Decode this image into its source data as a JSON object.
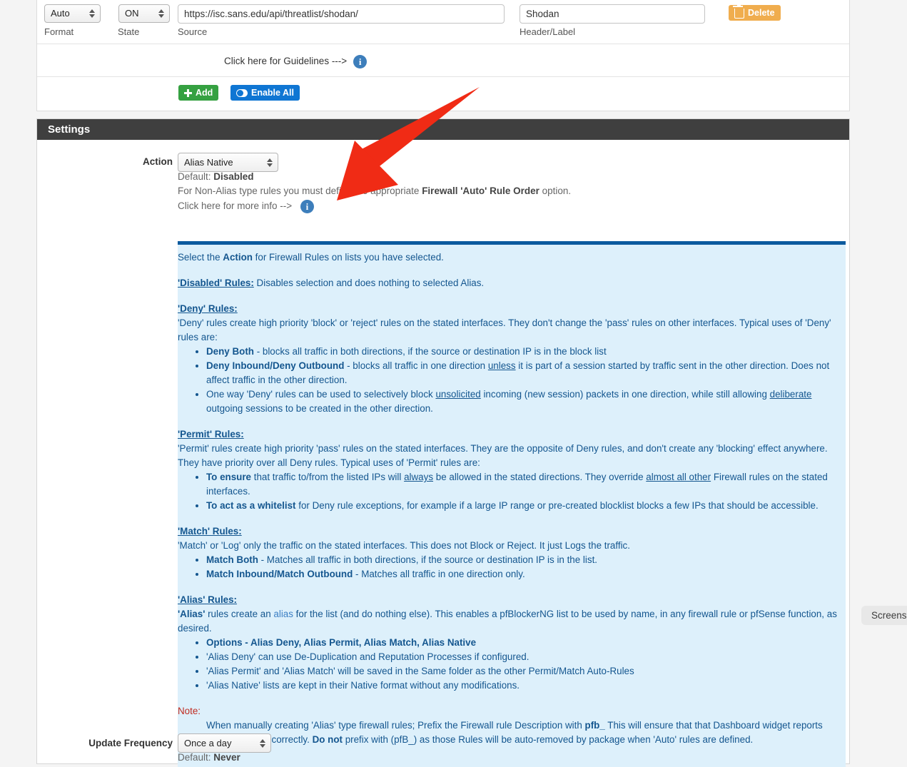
{
  "source_row": {
    "format": {
      "value": "Auto",
      "label": "Format"
    },
    "state": {
      "value": "ON",
      "label": "State"
    },
    "source": {
      "value": "https://isc.sans.edu/api/threatlist/shodan/",
      "label": "Source"
    },
    "header": {
      "value": "Shodan",
      "label": "Header/Label"
    },
    "delete_button": "Delete"
  },
  "guidelines_row": {
    "text": "Click here for Guidelines --->",
    "info_icon": "info-icon"
  },
  "actions_row": {
    "add_button": "Add",
    "enable_all_button": "Enable All"
  },
  "settings": {
    "heading": "Settings",
    "action": {
      "label": "Action",
      "value": "Alias Native",
      "default_prefix": "Default: ",
      "default_value": "Disabled",
      "note_pre": "For Non-Alias type rules you must define the appropriate ",
      "note_bold": "Firewall 'Auto' Rule Order",
      "note_post": " option.",
      "more_info": "Click here for more info -->"
    },
    "update_frequency": {
      "label": "Update Frequency",
      "value": "Once a day",
      "default_prefix": "Default: ",
      "default_value": "Never"
    }
  },
  "info_box": {
    "intro_pre": "Select the ",
    "intro_bold": "Action",
    "intro_post": " for Firewall Rules on lists you have selected.",
    "disabled_hdr": "'Disabled' Rules:",
    "disabled_text": " Disables selection and does nothing to selected Alias.",
    "deny_hdr": "'Deny' Rules:",
    "deny_intro": "'Deny' rules create high priority 'block' or 'reject' rules on the stated interfaces. They don't change the 'pass' rules on other interfaces. Typical uses of 'Deny' rules are:",
    "deny_b1_bold": "Deny Both",
    "deny_b1_rest": " - blocks all traffic in both directions, if the source or destination IP is in the block list",
    "deny_b2_bold": "Deny Inbound/Deny Outbound",
    "deny_b2_a": " - blocks all traffic in one direction ",
    "deny_b2_u": "unless",
    "deny_b2_b": " it is part of a session started by traffic sent in the other direction. Does not affect traffic in the other direction.",
    "deny_b3_a": "One way 'Deny' rules can be used to selectively block ",
    "deny_b3_u1": "unsolicited",
    "deny_b3_b": " incoming (new session) packets in one direction, while still allowing ",
    "deny_b3_u2": "deliberate",
    "deny_b3_c": " outgoing sessions to be created in the other direction.",
    "permit_hdr": "'Permit' Rules:",
    "permit_intro": "'Permit' rules create high priority 'pass' rules on the stated interfaces. They are the opposite of Deny rules, and don't create any 'blocking' effect anywhere. They have priority over all Deny rules. Typical uses of 'Permit' rules are:",
    "permit_b1_bold": "To ensure",
    "permit_b1_a": " that traffic to/from the listed IPs will ",
    "permit_b1_u1": "always",
    "permit_b1_b": " be allowed in the stated directions. They override ",
    "permit_b1_u2": "almost all other",
    "permit_b1_c": " Firewall rules on the stated interfaces.",
    "permit_b2_bold": "To act as a whitelist",
    "permit_b2_rest": " for Deny rule exceptions, for example if a large IP range or pre-created blocklist blocks a few IPs that should be accessible.",
    "match_hdr": "'Match' Rules:",
    "match_intro": "'Match' or 'Log' only the traffic on the stated interfaces. This does not Block or Reject. It just Logs the traffic.",
    "match_b1_bold": "Match Both",
    "match_b1_rest": " - Matches all traffic in both directions, if the source or destination IP is in the list.",
    "match_b2_bold": "Match Inbound/Match Outbound",
    "match_b2_rest": " - Matches all traffic in one direction only.",
    "alias_hdr": "'Alias' Rules:",
    "alias_intro_bold": "'Alias'",
    "alias_intro_a": " rules create an ",
    "alias_intro_link": "alias",
    "alias_intro_b": " for the list (and do nothing else). This enables a pfBlockerNG list to be used by name, in any firewall rule or pfSense function, as desired.",
    "alias_b1": "Options - Alias Deny,  Alias Permit,  Alias Match,  Alias Native",
    "alias_b2": "'Alias Deny' can use De-Duplication and Reputation Processes if configured.",
    "alias_b3": "'Alias Permit' and 'Alias Match' will be saved in the Same folder as the other Permit/Match Auto-Rules",
    "alias_b4": "'Alias Native' lists are kept in their Native format without any modifications.",
    "note_hdr": "Note:",
    "note_a": "When manually creating 'Alias' type firewall rules; Prefix the Firewall rule Description with ",
    "note_bold1": "pfb_",
    "note_b": " This will ensure that that Dashboard widget reports those statistics correctly. ",
    "note_bold2": "Do not",
    "note_c": " prefix with (pfB_) as those Rules will be auto-removed by package when 'Auto' rules are defined."
  },
  "overlay": {
    "arrow_color": "#f02b15",
    "screenshot_badge": "Screenshot"
  }
}
